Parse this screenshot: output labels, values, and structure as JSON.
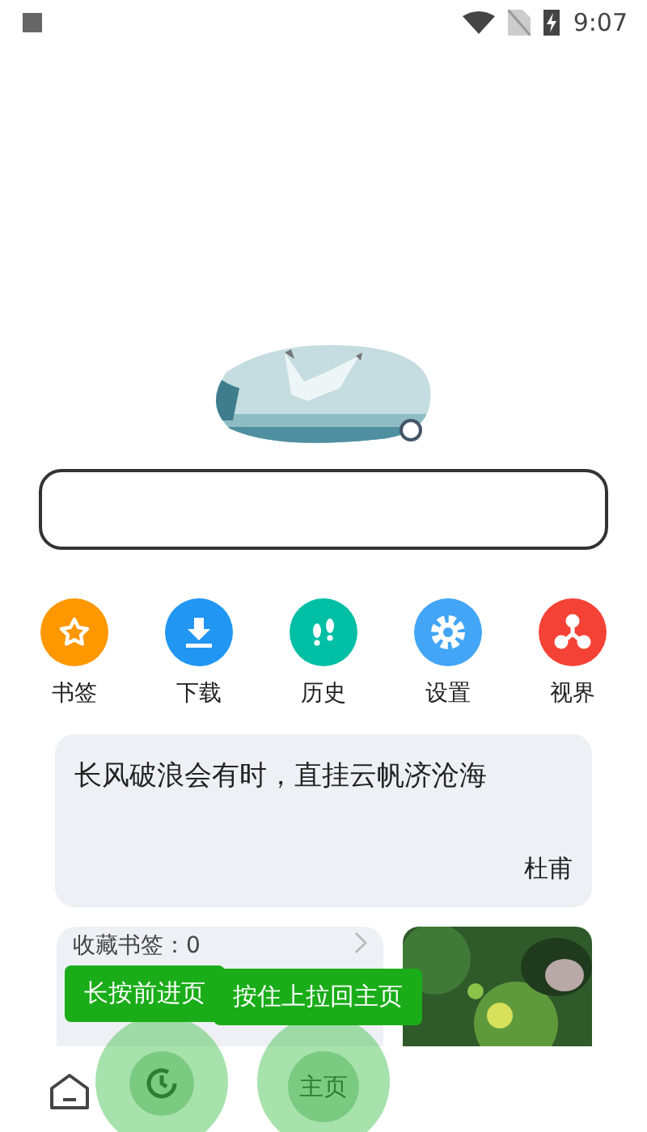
{
  "status_bar": {
    "time": "9:07"
  },
  "shortcuts": [
    {
      "label": "书签",
      "kind": "star",
      "color": "#ff9800"
    },
    {
      "label": "下载",
      "kind": "download",
      "color": "#2196f3"
    },
    {
      "label": "历史",
      "kind": "steps",
      "color": "#00bfa5"
    },
    {
      "label": "设置",
      "kind": "gear",
      "color": "#42a5f5"
    },
    {
      "label": "视界",
      "kind": "hub",
      "color": "#f44336"
    }
  ],
  "quote": {
    "text": "长风破浪会有时，直挂云帆济沧海",
    "author": "杜甫"
  },
  "bookmarks_card": {
    "title": "收藏书签：0"
  },
  "tips": [
    "长按前进页",
    "按住上拉回主页"
  ],
  "nav": {
    "home_label": "主页"
  }
}
